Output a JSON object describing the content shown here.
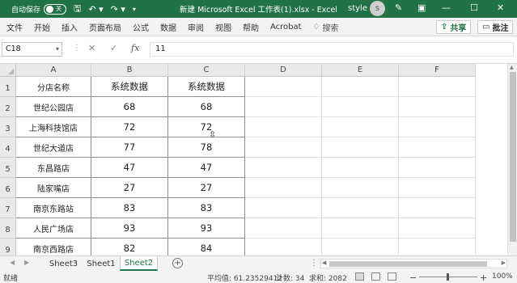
{
  "titlebar": {
    "autosave_label": "自动保存",
    "autosave_state": "关",
    "doc_title": "新建 Microsoft Excel 工作表(1).xlsx - Excel",
    "user_name": "style",
    "avatar_initial": "s",
    "bg_color": "#217346"
  },
  "ribbon": {
    "tabs": [
      "文件",
      "开始",
      "插入",
      "页面布局",
      "公式",
      "数据",
      "审阅",
      "视图",
      "帮助",
      "Acrobat"
    ],
    "search_label": "搜索",
    "share_label": "共享",
    "comments_label": "批注"
  },
  "formula_bar": {
    "name_box": "C18",
    "fx_label": "fx",
    "value": "11"
  },
  "grid": {
    "columns": [
      "A",
      "B",
      "C",
      "D",
      "E",
      "F"
    ],
    "rows": [
      "1",
      "2",
      "3",
      "4",
      "5",
      "6",
      "7",
      "8",
      "9"
    ],
    "headers": [
      "分店名称",
      "系统数据",
      "系统数据"
    ],
    "data": [
      [
        "世纪公园店",
        "68",
        "68"
      ],
      [
        "上海科技馆店",
        "72",
        "72"
      ],
      [
        "世纪大道店",
        "77",
        "78"
      ],
      [
        "东昌路店",
        "47",
        "47"
      ],
      [
        "陆家嘴店",
        "27",
        "27"
      ],
      [
        "南京东路站",
        "83",
        "83"
      ],
      [
        "人民广场店",
        "93",
        "93"
      ],
      [
        "南京西路店",
        "82",
        "84"
      ]
    ]
  },
  "sheets": {
    "tabs": [
      "Sheet3",
      "Sheet1",
      "Sheet2"
    ],
    "active_index": 2
  },
  "status": {
    "ready": "就绪",
    "average": "平均值: 61.23529412",
    "count": "计数: 34",
    "sum": "求和: 2082",
    "zoom": "100%"
  }
}
